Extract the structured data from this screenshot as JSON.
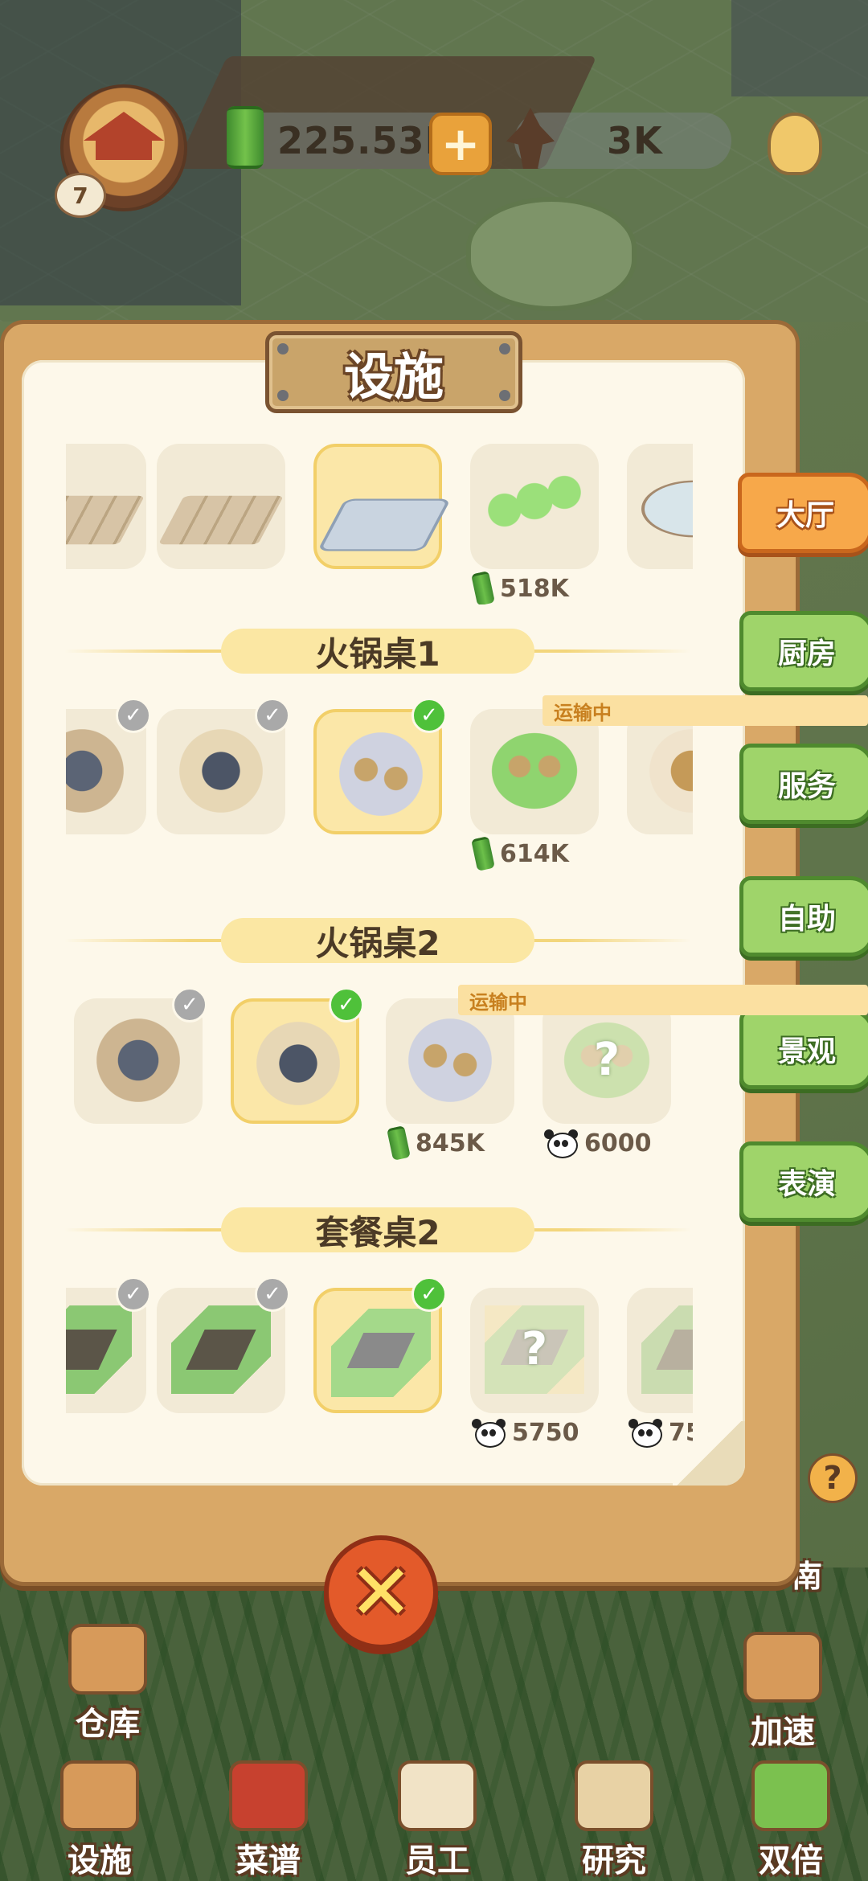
{
  "hud": {
    "level": "7",
    "bamboo_amount": "225.53K",
    "bamboo_shoot_amount": "3K",
    "icons": [
      "bamboo-icon",
      "plus-icon",
      "bamboo-shoot-icon",
      "lightbulb-icon"
    ]
  },
  "panel": {
    "title": "设施",
    "tabs": [
      {
        "label": "大厅",
        "active": true
      },
      {
        "label": "厨房",
        "active": false
      },
      {
        "label": "服务",
        "active": false
      },
      {
        "label": "自助",
        "active": false
      },
      {
        "label": "景观",
        "active": false
      },
      {
        "label": "表演",
        "active": false
      }
    ],
    "sections": [
      {
        "name": "",
        "items": [
          {
            "state": "owned"
          },
          {
            "state": "owned"
          },
          {
            "state": "equipped"
          },
          {
            "state": "purchasable",
            "price": "518K",
            "currency": "bamboo"
          },
          {
            "state": "owned"
          }
        ]
      },
      {
        "name": "火锅桌1",
        "items": [
          {
            "state": "owned"
          },
          {
            "state": "owned"
          },
          {
            "state": "equipped"
          },
          {
            "state": "in_transit",
            "badge": "运输中",
            "price": "614K",
            "currency": "bamboo"
          },
          {
            "state": "owned"
          }
        ]
      },
      {
        "name": "火锅桌2",
        "items": [
          {
            "state": "owned"
          },
          {
            "state": "equipped"
          },
          {
            "state": "in_transit",
            "badge": "运输中",
            "price": "845K",
            "currency": "bamboo"
          },
          {
            "state": "locked",
            "price": "6000",
            "currency": "panda"
          }
        ]
      },
      {
        "name": "套餐桌2",
        "items": [
          {
            "state": "owned"
          },
          {
            "state": "owned"
          },
          {
            "state": "equipped"
          },
          {
            "state": "locked",
            "price": "5750",
            "currency": "panda"
          },
          {
            "state": "locked",
            "price": "75",
            "currency": "panda"
          }
        ]
      }
    ],
    "close_icon": "close-icon"
  },
  "bottom_bar": {
    "warehouse": "仓库",
    "speed_up": "加速",
    "facility": "设施",
    "menu": "菜谱",
    "staff": "员工",
    "research": "研究",
    "double": "双倍",
    "side_label_fragment": "南"
  },
  "colors": {
    "paper": "#fdf8ea",
    "panel_wood": "#d9a867",
    "tab_active": "#f7a84a",
    "tab_inactive": "#9fd46a",
    "check_equipped": "#4fc13a",
    "check_owned": "#a9a9a9",
    "section_pill": "#fbe7a3"
  }
}
